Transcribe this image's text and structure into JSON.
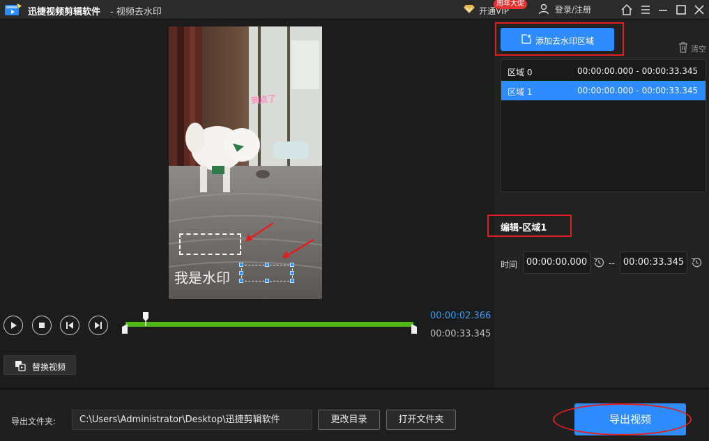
{
  "titlebar": {
    "app_name": "迅捷视频剪辑软件",
    "page_title": "- 视频去水印",
    "vip_label": "开通VIP",
    "promo_badge": "周年大促",
    "login_label": "登录/注册"
  },
  "preview": {
    "sticker_text": "到点了",
    "watermark_text": "我是水印"
  },
  "playback": {
    "current_time": "00:00:02.366",
    "total_time": "00:00:33.345",
    "playhead_fraction": 0.071
  },
  "left_actions": {
    "replace_video_label": "替换视频"
  },
  "regions_panel": {
    "add_button_label": "添加去水印区域",
    "clear_label": "清空",
    "regions": [
      {
        "name": "区域 0",
        "range": "00:00:00.000 - 00:00:33.345",
        "selected": false
      },
      {
        "name": "区域 1",
        "range": "00:00:00.000 - 00:00:33.345",
        "selected": true
      }
    ]
  },
  "edit_panel": {
    "title": "编辑-区域1",
    "time_label": "时间",
    "start_time": "00:00:00.000",
    "separator": "--",
    "end_time": "00:00:33.345"
  },
  "bottom_bar": {
    "export_folder_label": "导出文件夹:",
    "export_path": "C:\\Users\\Administrator\\Desktop\\迅捷剪辑软件",
    "change_dir_label": "更改目录",
    "open_folder_label": "打开文件夹",
    "export_label": "导出视频"
  },
  "colors": {
    "accent": "#2f8cff",
    "timeline_green": "#52b715",
    "annotation_red": "#e02020"
  }
}
